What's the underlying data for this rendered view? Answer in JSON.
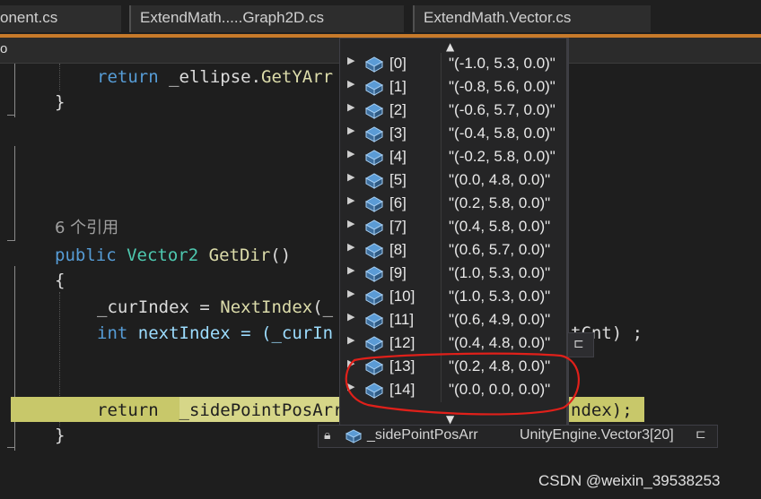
{
  "tabs": [
    {
      "label": "onent.cs"
    },
    {
      "label": "ExtendMath.....Graph2D.cs"
    },
    {
      "label": "ExtendMath.Vector.cs"
    }
  ],
  "nav": {
    "label": "o"
  },
  "code": {
    "line1_kw": "return",
    "line1_obj": " _ellipse.",
    "line1_fn": "GetYArr",
    "brace_close": "}",
    "refcount": "6 个引用",
    "sig_kw": "public",
    "sig_type": "Vector2",
    "sig_fn": "GetDir",
    "sig_paren": "()",
    "brace_open": "{",
    "cur_lhs": "_curIndex = ",
    "cur_fn": "NextIndex",
    "cur_tail": "(_",
    "int_kw": "int",
    "next_var": " nextIndex = (_curIn",
    "next_tail": "tCnt) ;",
    "ret_kw": "return",
    "ret_sel": "_sidePointPosArr",
    "ret_tail": "ndex);",
    "brace_close2": "}"
  },
  "datatip": {
    "up_arrow": "▲",
    "down_arrow": "▼",
    "items": [
      {
        "name": "[0]",
        "value": "\"(-1.0, 5.3, 0.0)\""
      },
      {
        "name": "[1]",
        "value": "\"(-0.8, 5.6, 0.0)\""
      },
      {
        "name": "[2]",
        "value": "\"(-0.6, 5.7, 0.0)\""
      },
      {
        "name": "[3]",
        "value": "\"(-0.4, 5.8, 0.0)\""
      },
      {
        "name": "[4]",
        "value": "\"(-0.2, 5.8, 0.0)\""
      },
      {
        "name": "[5]",
        "value": "\"(0.0, 4.8, 0.0)\""
      },
      {
        "name": "[6]",
        "value": "\"(0.2, 5.8, 0.0)\""
      },
      {
        "name": "[7]",
        "value": "\"(0.4, 5.8, 0.0)\""
      },
      {
        "name": "[8]",
        "value": "\"(0.6, 5.7, 0.0)\""
      },
      {
        "name": "[9]",
        "value": "\"(1.0, 5.3, 0.0)\""
      },
      {
        "name": "[10]",
        "value": "\"(1.0, 5.3, 0.0)\""
      },
      {
        "name": "[11]",
        "value": "\"(0.6, 4.9, 0.0)\""
      },
      {
        "name": "[12]",
        "value": "\"(0.4, 4.8, 0.0)\""
      },
      {
        "name": "[13]",
        "value": "\"(0.2, 4.8, 0.0)\""
      },
      {
        "name": "[14]",
        "value": "\"(0.0, 0.0, 0.0)\""
      }
    ]
  },
  "root": {
    "name": "_sidePointPosArr",
    "value": "UnityEngine.Vector3[20]",
    "lock_icon": "lock-icon",
    "pin_icon": "pin-icon"
  },
  "annotation": {
    "color": "#e0201a"
  },
  "watermark": "CSDN @weixin_39538253"
}
